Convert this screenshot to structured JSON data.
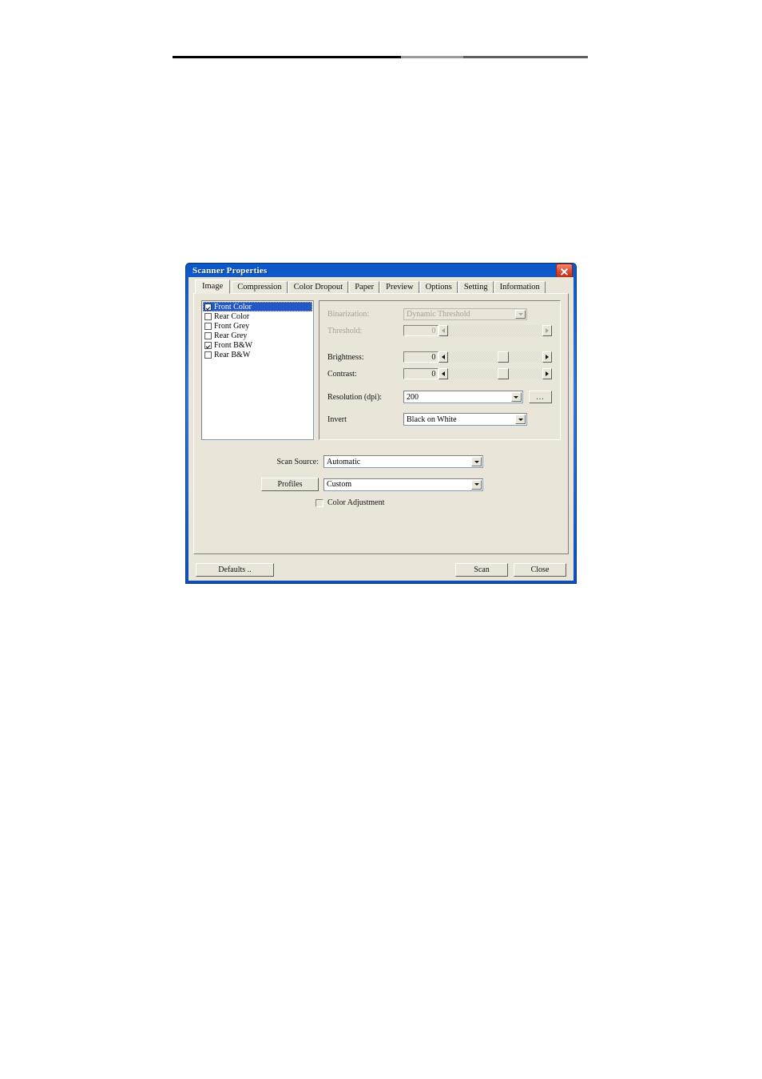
{
  "dialog": {
    "title": "Scanner Properties",
    "close_icon": "close-icon",
    "tabs": [
      {
        "label": "Image",
        "active": true
      },
      {
        "label": "Compression",
        "active": false
      },
      {
        "label": "Color Dropout",
        "active": false
      },
      {
        "label": "Paper",
        "active": false
      },
      {
        "label": "Preview",
        "active": false
      },
      {
        "label": "Options",
        "active": false
      },
      {
        "label": "Setting",
        "active": false
      },
      {
        "label": "Information",
        "active": false
      }
    ],
    "image_selection": [
      {
        "label": "Front Color",
        "checked": true,
        "selected": true
      },
      {
        "label": "Rear Color",
        "checked": false,
        "selected": false
      },
      {
        "label": "Front Grey",
        "checked": false,
        "selected": false
      },
      {
        "label": "Rear Grey",
        "checked": false,
        "selected": false
      },
      {
        "label": "Front B&W",
        "checked": true,
        "selected": false
      },
      {
        "label": "Rear B&W",
        "checked": false,
        "selected": false
      }
    ],
    "settings": {
      "binarization_label": "Binarization:",
      "binarization_value": "Dynamic Threshold",
      "threshold_label": "Threshold:",
      "threshold_value": "0",
      "brightness_label": "Brightness:",
      "brightness_value": "0",
      "contrast_label": "Contrast:",
      "contrast_value": "0",
      "resolution_label": "Resolution (dpi):",
      "resolution_value": "200",
      "resolution_more_label": "...",
      "invert_label": "Invert",
      "invert_value": "Black on White"
    },
    "form": {
      "scan_source_label": "Scan Source:",
      "scan_source_value": "Automatic",
      "profiles_button": "Profiles",
      "profile_value": "Custom",
      "color_adjustment_label": "Color Adjustment",
      "color_adjustment_checked": false
    },
    "buttons": {
      "defaults": "Defaults ..",
      "scan": "Scan",
      "close": "Close"
    },
    "colors": {
      "titlebar_blue": "#0b57c8",
      "dialog_face": "#e9e5d9",
      "selection_blue": "#2157c8",
      "close_red": "#c32d17"
    }
  }
}
